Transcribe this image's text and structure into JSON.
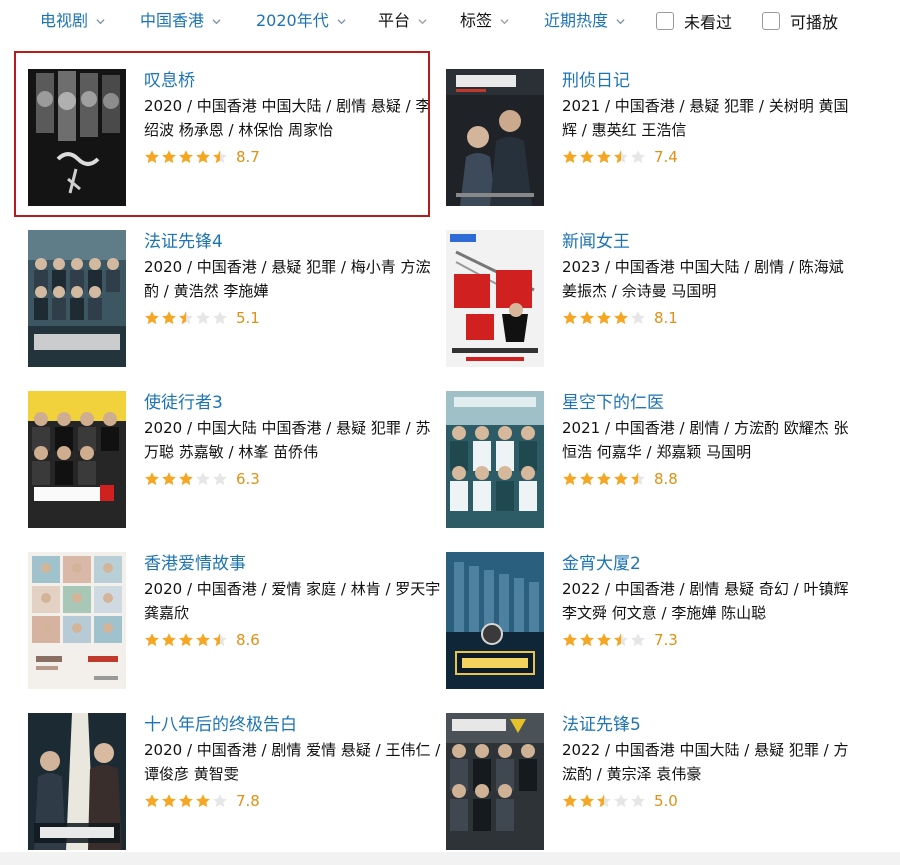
{
  "filters": [
    {
      "label": "电视剧",
      "color": "#1d74b5"
    },
    {
      "label": "中国香港",
      "color": "#1d74b5"
    },
    {
      "label": "2020年代",
      "color": "#1d74b5"
    },
    {
      "label": "平台",
      "color": "#111111"
    },
    {
      "label": "标签",
      "color": "#111111"
    },
    {
      "label": "近期热度",
      "color": "#1d74b5"
    }
  ],
  "checkboxes": [
    {
      "label": "未看过",
      "checked": false
    },
    {
      "label": "可播放",
      "checked": false
    }
  ],
  "colors": {
    "link": "#1d74b5",
    "star": "#f5a623",
    "star_empty": "#e6e6e6",
    "score": "#e09015",
    "highlight": "#b71c1c"
  },
  "items": [
    {
      "title": "叹息桥",
      "meta": "2020 / 中国香港 中国大陆 / 剧情 悬疑 / 李绍波 杨承恩 / 林保怡 周家怡",
      "stars": 4.5,
      "score": "8.7",
      "highlighted": true,
      "poster_icon": "poster-dark-portraits"
    },
    {
      "title": "刑侦日记",
      "meta": "2021 / 中国香港 / 悬疑 犯罪 / 关树明 黄国辉 / 惠英红 王浩信",
      "stars": 3.5,
      "score": "7.4",
      "highlighted": false,
      "poster_icon": "poster-duo-dark"
    },
    {
      "title": "法证先锋4",
      "meta": "2020 / 中国香港 / 悬疑 犯罪 / 梅小青 方浤酌 / 黄浩然 李施嬅",
      "stars": 2.5,
      "score": "5.1",
      "highlighted": false,
      "poster_icon": "poster-group-teal"
    },
    {
      "title": "新闻女王",
      "meta": "2023 / 中国香港 中国大陆 / 剧情 / 陈海斌 姜振杰 / 佘诗曼 马国明",
      "stars": 4,
      "score": "8.1",
      "highlighted": false,
      "poster_icon": "poster-light-red-title"
    },
    {
      "title": "使徒行者3",
      "meta": "2020 / 中国大陆 中国香港 / 悬疑 犯罪 / 苏万聪 苏嘉敏 / 林峯 苗侨伟",
      "stars": 3,
      "score": "6.3",
      "highlighted": false,
      "poster_icon": "poster-yellow-group"
    },
    {
      "title": "星空下的仁医",
      "meta": "2021 / 中国香港 / 剧情 / 方浤酌 欧耀杰 张恒浩 何嘉华 / 郑嘉颖 马国明",
      "stars": 4.5,
      "score": "8.8",
      "highlighted": false,
      "poster_icon": "poster-hospital-teal"
    },
    {
      "title": "香港爱情故事",
      "meta": "2020 / 中国香港 / 爱情 家庭 / 林肯 / 罗天宇 龚嘉欣",
      "stars": 4.5,
      "score": "8.6",
      "highlighted": false,
      "poster_icon": "poster-tiles-light"
    },
    {
      "title": "金宵大厦2",
      "meta": "2022 / 中国香港 / 剧情 悬疑 奇幻 / 叶镇辉 李文舜 何文意 / 李施嬅 陈山聪",
      "stars": 3.5,
      "score": "7.3",
      "highlighted": false,
      "poster_icon": "poster-building-blue"
    },
    {
      "title": "十八年后的终极告白",
      "meta": "2020 / 中国香港 / 剧情 爱情 悬疑 / 王伟仁 / 谭俊彦 黄智雯",
      "stars": 4,
      "score": "7.8",
      "highlighted": false,
      "poster_icon": "poster-light-beam"
    },
    {
      "title": "法证先锋5",
      "meta": "2022 / 中国香港 中国大陆 / 悬疑 犯罪 / 方浤酌 / 黄宗泽 袁伟豪",
      "stars": 2.5,
      "score": "5.0",
      "highlighted": false,
      "poster_icon": "poster-group-gray"
    }
  ]
}
